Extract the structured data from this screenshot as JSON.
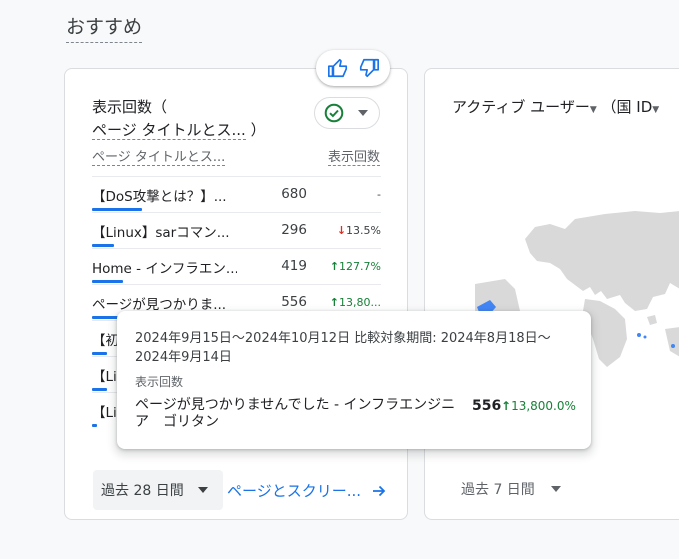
{
  "section_title": "おすすめ",
  "card1": {
    "title_part1": "表示回数（",
    "title_part2": "ページ タイトルとス...",
    "title_part3": "）",
    "col_page": "ページ タイトルとス...",
    "col_views": "表示回数",
    "rows": [
      {
        "name": "【DoS攻撃とは？】...",
        "value": "680",
        "change": "-",
        "dir": "none",
        "bar": 1.0
      },
      {
        "name": "【Linux】sarコマン...",
        "value": "296",
        "change": "13.5%",
        "dir": "down",
        "bar": 0.44
      },
      {
        "name": "Home - インフラエン...",
        "value": "419",
        "change": "127.7%",
        "dir": "up",
        "bar": 0.62
      },
      {
        "name": "ページが見つかりま...",
        "value": "556",
        "change": "13,80...",
        "dir": "up",
        "bar": 0.82
      },
      {
        "name": "【初",
        "value": "",
        "change": "",
        "dir": "none",
        "bar": 0.3
      },
      {
        "name": "【Li",
        "value": "",
        "change": "",
        "dir": "none",
        "bar": 0.3
      },
      {
        "name": "【Li",
        "value": "",
        "change": "",
        "dir": "none",
        "bar": 0.1
      }
    ],
    "date_range": "過去 28 日間",
    "link": "ページとスクリー..."
  },
  "tooltip": {
    "date": "2024年9月15日～2024年10月12日 比較対象期間: 2024年8月18日～2024年9月14日",
    "metric": "表示回数",
    "page": "ページが見つかりませんでした - インフラエンジニア　ゴリタン",
    "value": "556",
    "change": "13,800.0%"
  },
  "card2": {
    "title": "アクティブ ユーザー",
    "title_dim": "（国 ID",
    "date_range": "過去 7 日間"
  },
  "colors": {
    "accent": "#1a73e8",
    "positive": "#188038",
    "negative": "#d93025"
  }
}
